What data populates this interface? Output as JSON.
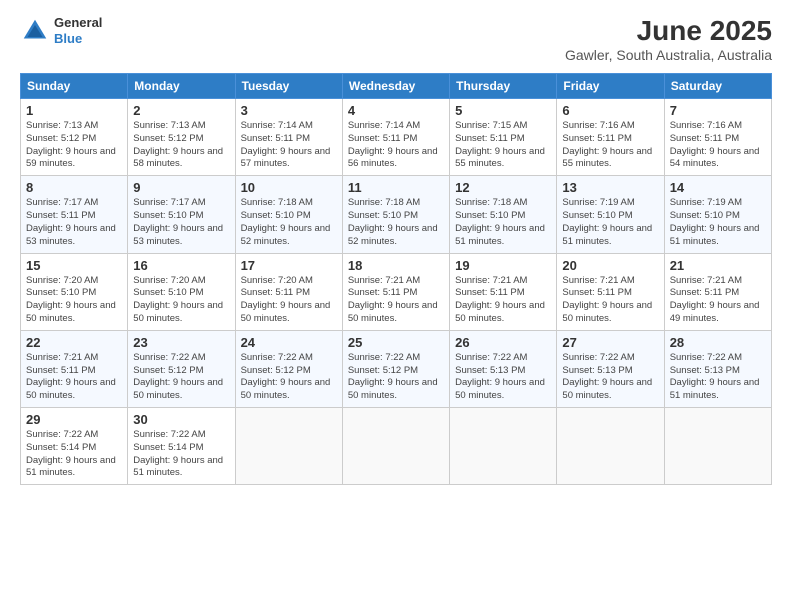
{
  "header": {
    "logo_line1": "General",
    "logo_line2": "Blue",
    "title": "June 2025",
    "subtitle": "Gawler, South Australia, Australia"
  },
  "weekdays": [
    "Sunday",
    "Monday",
    "Tuesday",
    "Wednesday",
    "Thursday",
    "Friday",
    "Saturday"
  ],
  "weeks": [
    [
      {
        "day": "1",
        "sunrise": "7:13 AM",
        "sunset": "5:12 PM",
        "daylight": "9 hours and 59 minutes."
      },
      {
        "day": "2",
        "sunrise": "7:13 AM",
        "sunset": "5:12 PM",
        "daylight": "9 hours and 58 minutes."
      },
      {
        "day": "3",
        "sunrise": "7:14 AM",
        "sunset": "5:11 PM",
        "daylight": "9 hours and 57 minutes."
      },
      {
        "day": "4",
        "sunrise": "7:14 AM",
        "sunset": "5:11 PM",
        "daylight": "9 hours and 56 minutes."
      },
      {
        "day": "5",
        "sunrise": "7:15 AM",
        "sunset": "5:11 PM",
        "daylight": "9 hours and 55 minutes."
      },
      {
        "day": "6",
        "sunrise": "7:16 AM",
        "sunset": "5:11 PM",
        "daylight": "9 hours and 55 minutes."
      },
      {
        "day": "7",
        "sunrise": "7:16 AM",
        "sunset": "5:11 PM",
        "daylight": "9 hours and 54 minutes."
      }
    ],
    [
      {
        "day": "8",
        "sunrise": "7:17 AM",
        "sunset": "5:11 PM",
        "daylight": "9 hours and 53 minutes."
      },
      {
        "day": "9",
        "sunrise": "7:17 AM",
        "sunset": "5:10 PM",
        "daylight": "9 hours and 53 minutes."
      },
      {
        "day": "10",
        "sunrise": "7:18 AM",
        "sunset": "5:10 PM",
        "daylight": "9 hours and 52 minutes."
      },
      {
        "day": "11",
        "sunrise": "7:18 AM",
        "sunset": "5:10 PM",
        "daylight": "9 hours and 52 minutes."
      },
      {
        "day": "12",
        "sunrise": "7:18 AM",
        "sunset": "5:10 PM",
        "daylight": "9 hours and 51 minutes."
      },
      {
        "day": "13",
        "sunrise": "7:19 AM",
        "sunset": "5:10 PM",
        "daylight": "9 hours and 51 minutes."
      },
      {
        "day": "14",
        "sunrise": "7:19 AM",
        "sunset": "5:10 PM",
        "daylight": "9 hours and 51 minutes."
      }
    ],
    [
      {
        "day": "15",
        "sunrise": "7:20 AM",
        "sunset": "5:10 PM",
        "daylight": "9 hours and 50 minutes."
      },
      {
        "day": "16",
        "sunrise": "7:20 AM",
        "sunset": "5:10 PM",
        "daylight": "9 hours and 50 minutes."
      },
      {
        "day": "17",
        "sunrise": "7:20 AM",
        "sunset": "5:11 PM",
        "daylight": "9 hours and 50 minutes."
      },
      {
        "day": "18",
        "sunrise": "7:21 AM",
        "sunset": "5:11 PM",
        "daylight": "9 hours and 50 minutes."
      },
      {
        "day": "19",
        "sunrise": "7:21 AM",
        "sunset": "5:11 PM",
        "daylight": "9 hours and 50 minutes."
      },
      {
        "day": "20",
        "sunrise": "7:21 AM",
        "sunset": "5:11 PM",
        "daylight": "9 hours and 50 minutes."
      },
      {
        "day": "21",
        "sunrise": "7:21 AM",
        "sunset": "5:11 PM",
        "daylight": "9 hours and 49 minutes."
      }
    ],
    [
      {
        "day": "22",
        "sunrise": "7:21 AM",
        "sunset": "5:11 PM",
        "daylight": "9 hours and 50 minutes."
      },
      {
        "day": "23",
        "sunrise": "7:22 AM",
        "sunset": "5:12 PM",
        "daylight": "9 hours and 50 minutes."
      },
      {
        "day": "24",
        "sunrise": "7:22 AM",
        "sunset": "5:12 PM",
        "daylight": "9 hours and 50 minutes."
      },
      {
        "day": "25",
        "sunrise": "7:22 AM",
        "sunset": "5:12 PM",
        "daylight": "9 hours and 50 minutes."
      },
      {
        "day": "26",
        "sunrise": "7:22 AM",
        "sunset": "5:13 PM",
        "daylight": "9 hours and 50 minutes."
      },
      {
        "day": "27",
        "sunrise": "7:22 AM",
        "sunset": "5:13 PM",
        "daylight": "9 hours and 50 minutes."
      },
      {
        "day": "28",
        "sunrise": "7:22 AM",
        "sunset": "5:13 PM",
        "daylight": "9 hours and 51 minutes."
      }
    ],
    [
      {
        "day": "29",
        "sunrise": "7:22 AM",
        "sunset": "5:14 PM",
        "daylight": "9 hours and 51 minutes."
      },
      {
        "day": "30",
        "sunrise": "7:22 AM",
        "sunset": "5:14 PM",
        "daylight": "9 hours and 51 minutes."
      },
      null,
      null,
      null,
      null,
      null
    ]
  ]
}
